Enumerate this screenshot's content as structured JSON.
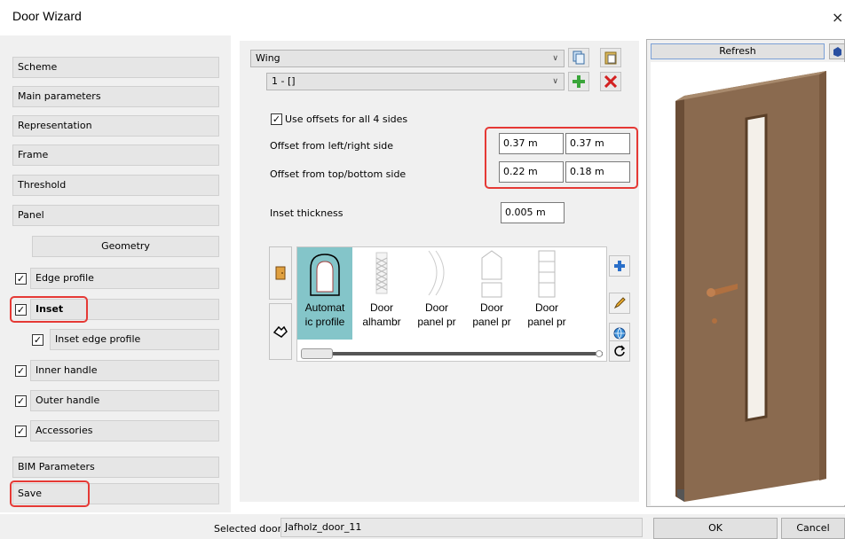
{
  "window": {
    "title": "Door Wizard",
    "close_glyph": "×"
  },
  "nav": {
    "scheme": "Scheme",
    "main_parameters": "Main parameters",
    "representation": "Representation",
    "frame": "Frame",
    "threshold": "Threshold",
    "panel": "Panel",
    "geometry": "Geometry",
    "edge_profile": "Edge profile",
    "inset": "Inset",
    "inset_edge_profile": "Inset edge profile",
    "inner_handle": "Inner handle",
    "outer_handle": "Outer handle",
    "accessories": "Accessories",
    "bim_parameters": "BIM Parameters",
    "save": "Save",
    "checked": {
      "edge_profile": true,
      "inset": true,
      "inset_edge_profile": true,
      "inner_handle": true,
      "outer_handle": true,
      "accessories": true
    }
  },
  "wing": {
    "selector": "Wing",
    "item": "1 - []"
  },
  "offsets": {
    "use_all_label": "Use offsets for all 4 sides",
    "use_all_checked": true,
    "left_right_label": "Offset from left/right side",
    "left_value": "0.37 m",
    "right_value": "0.37 m",
    "top_bottom_label": "Offset from top/bottom side",
    "top_value": "0.22 m",
    "bottom_value": "0.18 m",
    "thickness_label": "Inset thickness",
    "thickness_value": "0.005 m"
  },
  "library": {
    "items": [
      {
        "line1": "Automat",
        "line2": "ic profile",
        "selected": true
      },
      {
        "line1": "Door",
        "line2": "alhambr"
      },
      {
        "line1": "Door",
        "line2": "panel pr"
      },
      {
        "line1": "Door",
        "line2": "panel pr"
      },
      {
        "line1": "Door",
        "line2": "panel pr"
      }
    ]
  },
  "preview": {
    "refresh": "Refresh"
  },
  "footer": {
    "selected_door_label": "Selected door",
    "selected_door_value": "Jafholz_door_11",
    "ok": "OK",
    "cancel": "Cancel"
  },
  "colors": {
    "highlight_red": "#e53935",
    "door_wood": "#8a6a4f",
    "selected_tile": "#84c5c9"
  }
}
